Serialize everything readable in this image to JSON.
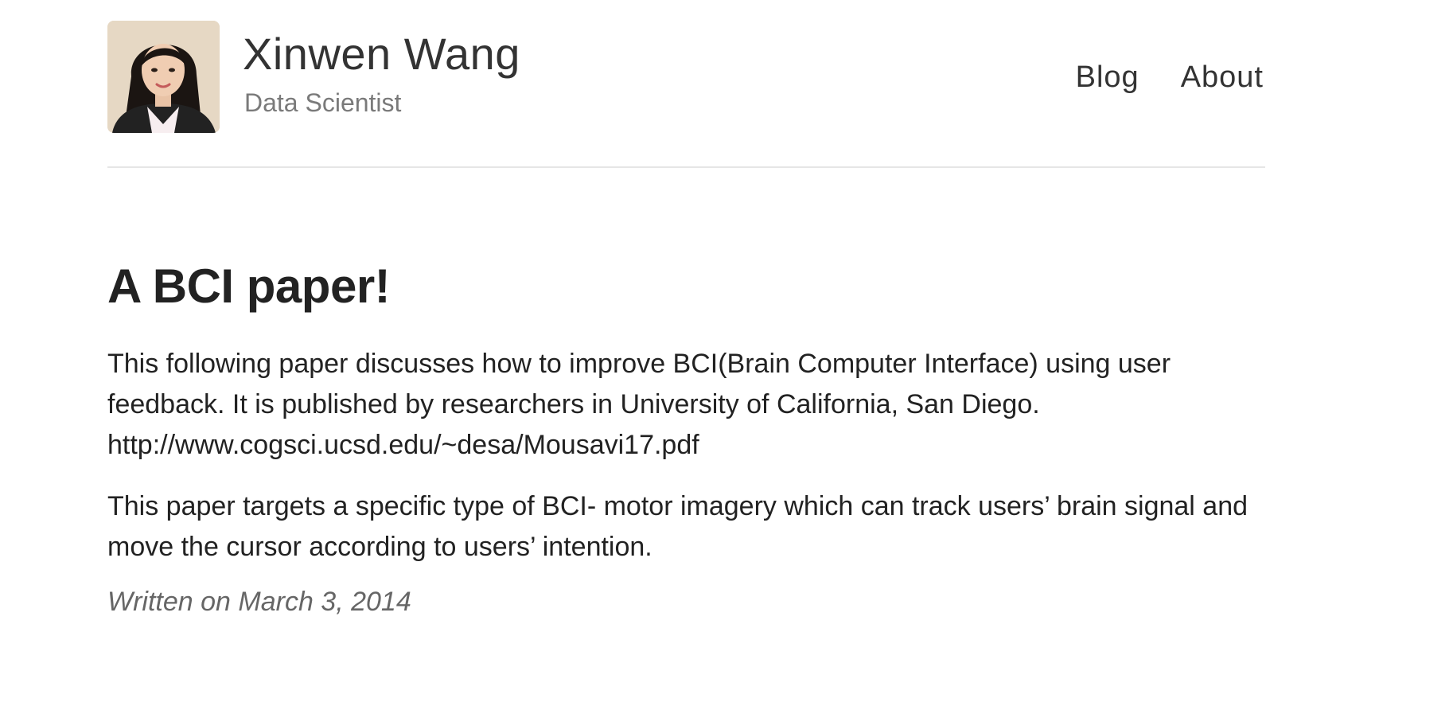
{
  "header": {
    "site_name": "Xinwen Wang",
    "site_description": "Data Scientist"
  },
  "nav": {
    "items": [
      "Blog",
      "About"
    ]
  },
  "post": {
    "title": "A BCI paper!",
    "paragraph_1": "This following paper discusses how to improve BCI(Brain Computer Interface) using user feedback. It is published by researchers in University of California, San Diego.",
    "link": "http://www.cogsci.ucsd.edu/~desa/Mousavi17.pdf",
    "paragraph_2": "This paper targets a specific type of BCI- motor imagery which can track users’ brain signal and move the cursor according to users’ intention.",
    "date": "Written on March 3, 2014"
  }
}
